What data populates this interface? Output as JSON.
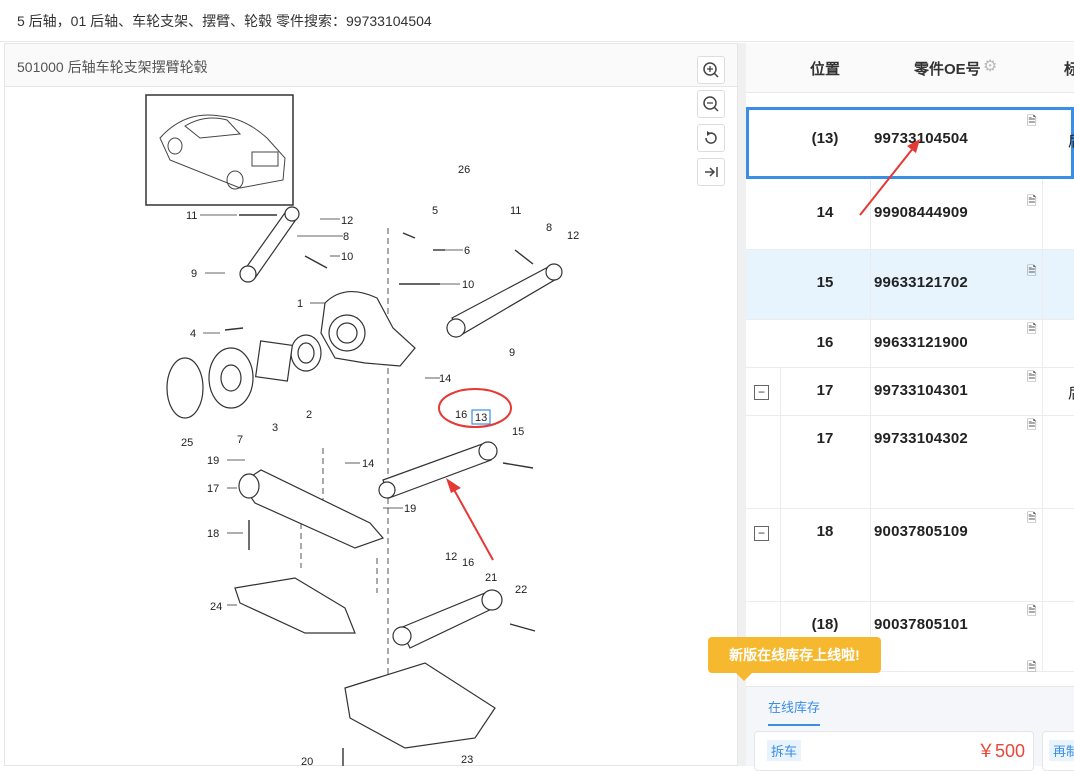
{
  "breadcrumb": "5 后轴，01 后轴、车轮支架、摆臂、轮毂 零件搜索：99733104504",
  "diagram_panel": {
    "title": "501000 后轴车轮支架摆臂轮毂",
    "callouts": [
      "26",
      "5",
      "11",
      "12",
      "8",
      "10",
      "6",
      "9",
      "1",
      "4",
      "14",
      "16",
      "13",
      "15",
      "19",
      "7",
      "3",
      "2",
      "25",
      "17",
      "18",
      "24",
      "21",
      "22",
      "20",
      "23"
    ],
    "highlighted_callout": "13",
    "zoom_tools": [
      "zoom-in-icon",
      "zoom-out-icon",
      "rotate-icon",
      "fit-icon"
    ]
  },
  "table": {
    "headers": {
      "position": "位置",
      "oe": "零件OE号",
      "extra": "标"
    },
    "rows": [
      {
        "position": "(13)",
        "oe": "99733104504",
        "extra": "后",
        "selected": true,
        "expander": ""
      },
      {
        "position": "14",
        "oe": "99908444909",
        "extra": "",
        "selected": false,
        "expander": ""
      },
      {
        "position": "15",
        "oe": "99633121702",
        "extra": "",
        "highlight": true,
        "expander": ""
      },
      {
        "position": "16",
        "oe": "99633121900",
        "extra": "",
        "expander": ""
      },
      {
        "position": "17",
        "oe": "99733104301",
        "extra": "后",
        "expander": "−"
      },
      {
        "position": "17",
        "oe": "99733104302",
        "extra": "",
        "expander": ""
      },
      {
        "position": "18",
        "oe": "90037805109",
        "extra": "",
        "expander": "−"
      },
      {
        "position": "(18)",
        "oe": "90037805101",
        "extra": "",
        "expander": ""
      }
    ]
  },
  "tooltip": "新版在线库存上线啦!",
  "stock": {
    "tab": "在线库存",
    "card1_badge": "拆车",
    "card1_price": "￥500",
    "card2_badge": "再制"
  },
  "colors": {
    "accent": "#3a8ee6",
    "tooltip": "#f5b82e",
    "price": "#e5483a",
    "annotation": "#e53935"
  }
}
